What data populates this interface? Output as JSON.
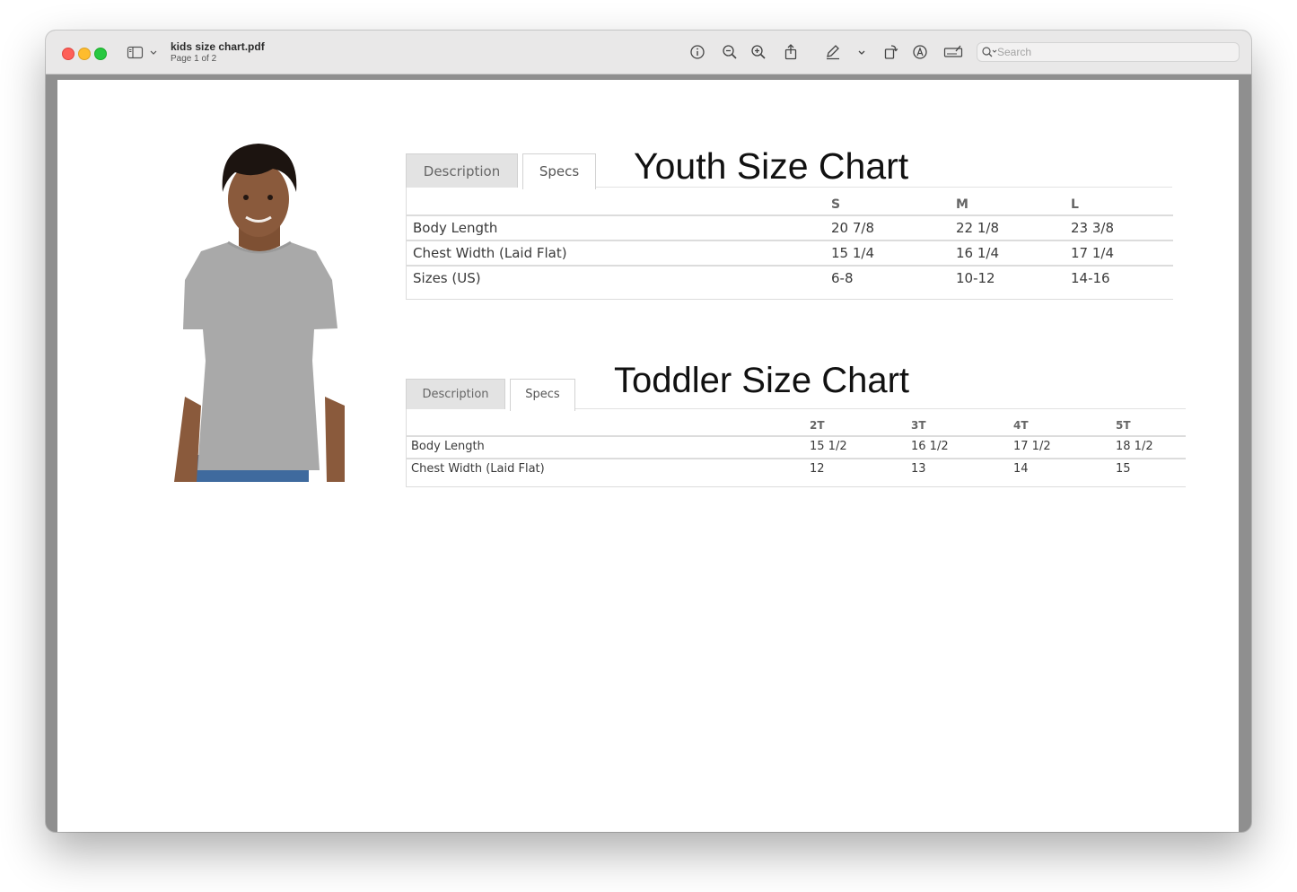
{
  "app": {
    "document_title": "kids size chart.pdf",
    "page_indicator": "Page 1 of 2"
  },
  "toolbar": {
    "icons": [
      "info-icon",
      "zoom-out-icon",
      "zoom-in-icon",
      "share-icon",
      "markup-pen-icon",
      "chevron-down-icon",
      "rotate-icon",
      "annotate-icon",
      "signature-icon"
    ],
    "search_placeholder": "Search"
  },
  "youth": {
    "tabs": [
      "Description",
      "Specs"
    ],
    "active_tab": "Specs",
    "title": "Youth Size Chart",
    "columns": [
      "S",
      "M",
      "L"
    ],
    "rows": [
      {
        "label": "Body Length",
        "values": [
          "20 7/8",
          "22 1/8",
          "23 3/8"
        ]
      },
      {
        "label": "Chest Width (Laid Flat)",
        "values": [
          "15 1/4",
          "16 1/4",
          "17 1/4"
        ]
      },
      {
        "label": "Sizes (US)",
        "values": [
          "6-8",
          "10-12",
          "14-16"
        ]
      }
    ]
  },
  "toddler": {
    "tabs": [
      "Description",
      "Specs"
    ],
    "active_tab": "Specs",
    "title": "Toddler Size Chart",
    "columns": [
      "2T",
      "3T",
      "4T",
      "5T"
    ],
    "rows": [
      {
        "label": "Body Length",
        "values": [
          "15 1/2",
          "16 1/2",
          "17 1/2",
          "18 1/2"
        ]
      },
      {
        "label": "Chest Width (Laid Flat)",
        "values": [
          "12",
          "13",
          "14",
          "15"
        ]
      }
    ]
  },
  "image": {
    "subject": "child-model-gray-tshirt"
  },
  "colors": {
    "tshirt": "#a9a9a9",
    "jeans": "#3f6a9e",
    "skin": "#8a5a3c",
    "hair": "#1c1410"
  }
}
